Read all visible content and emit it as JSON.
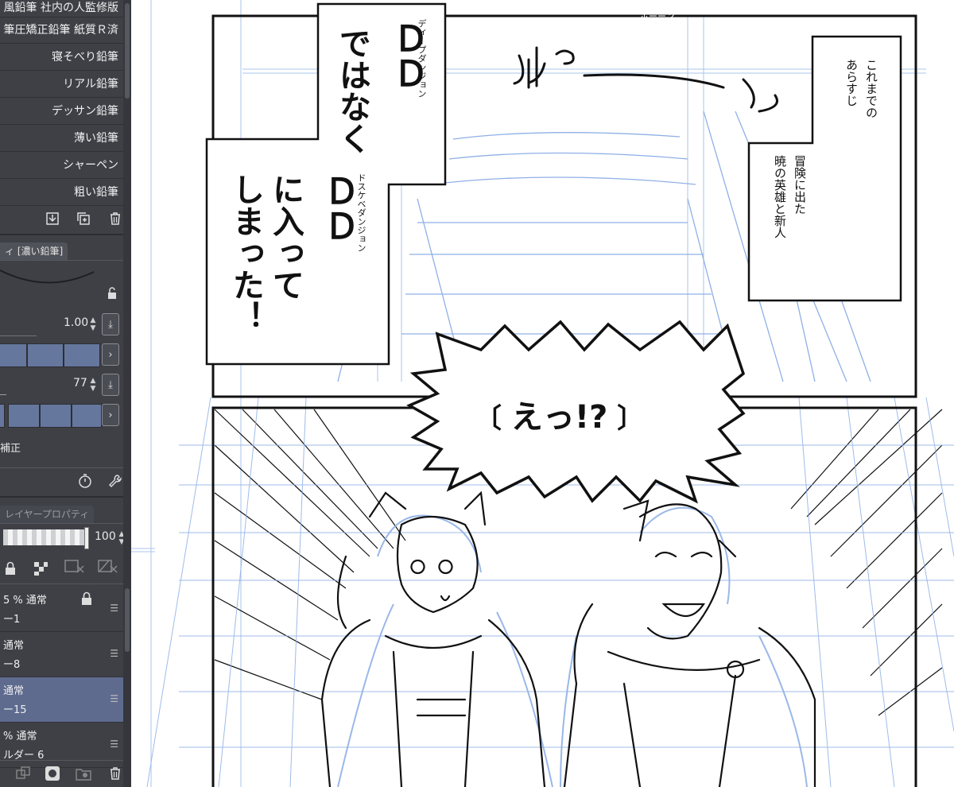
{
  "brush_list": {
    "items": [
      "風鉛筆 社内の人監修版",
      "筆圧矯正鉛筆 紙質Ｒ済",
      "寝そべり鉛筆",
      "リアル鉛筆",
      "デッサン鉛筆",
      "薄い鉛筆",
      "シャーペン",
      "粗い鉛筆"
    ]
  },
  "tool_property": {
    "tab_label": "ィ [濃い鉛筆]",
    "brush_size_value": "1.00",
    "opacity_value": "77",
    "correction_label": "補正"
  },
  "layer_panel": {
    "tab_label": "レイヤープロパティ",
    "opacity_value": "100",
    "layers": [
      {
        "line1": "5 % 通常",
        "line2": "ー1",
        "selected": false,
        "locked": true
      },
      {
        "line1": "通常",
        "line2": "ー8",
        "selected": false,
        "locked": false
      },
      {
        "line1": "通常",
        "line2": "ー15",
        "selected": true,
        "locked": false
      },
      {
        "line1": "% 通常",
        "line2": "ルダー 6",
        "selected": false,
        "locked": false
      }
    ]
  },
  "manga": {
    "caption_dd1": "ＤＤ",
    "caption_dd1_ruby": "ディープダンジョン",
    "caption_line2": "ではなく",
    "caption_dd2": "ＤＤ",
    "caption_dd2_ruby": "ドスケベダンジョン",
    "caption_line4": "に入って",
    "caption_line5": "しまった！",
    "sfx_pon": "ポーーン",
    "recap_line1": "これまでの",
    "recap_line2": "あらすじ",
    "recap_line3": "冒険に出た",
    "recap_line4": "暁の英雄と新人",
    "speech_bubble": "えっ!?"
  },
  "colors": {
    "panel_bg": "#3e4046",
    "selection": "#5e6b8f",
    "swatch": "#66779e",
    "guide_blue": "#8fb0e6",
    "ink": "#111111"
  }
}
